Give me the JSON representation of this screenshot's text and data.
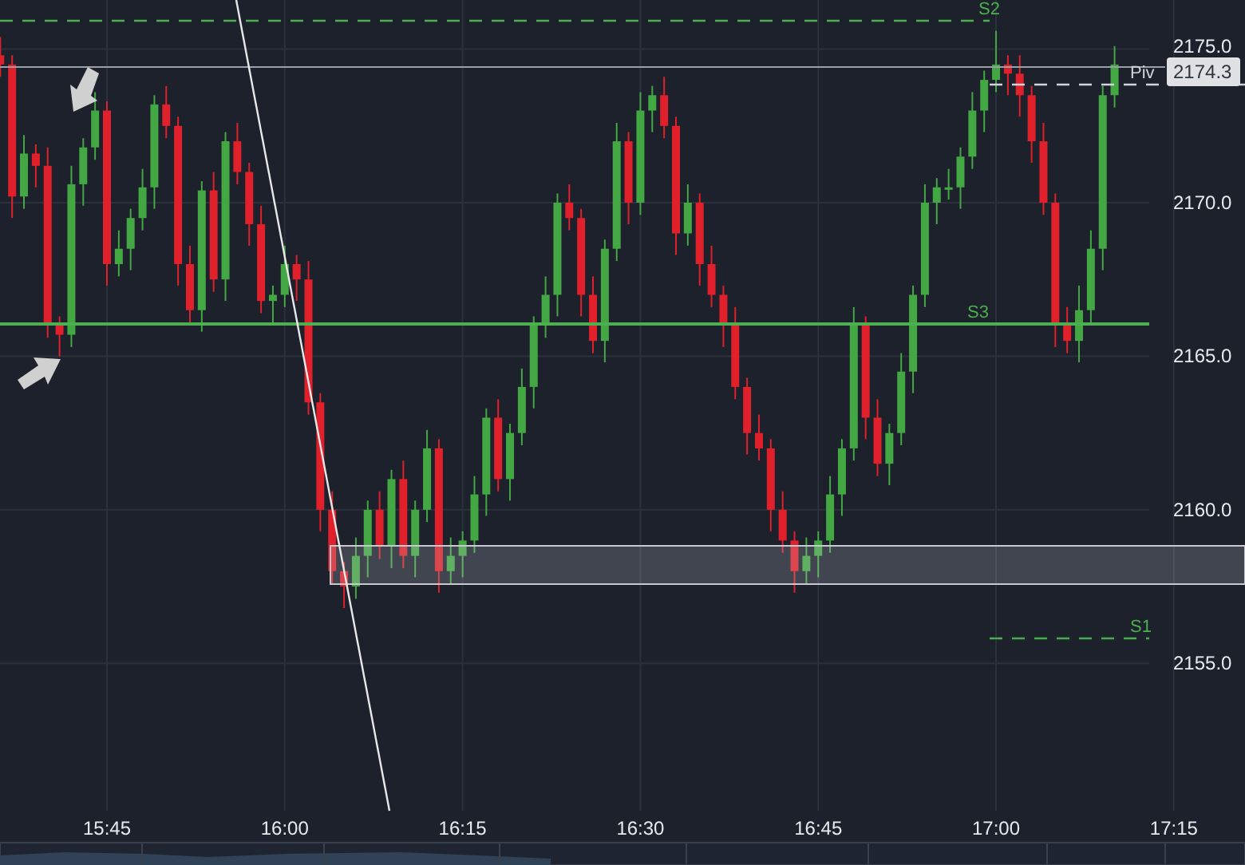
{
  "chart_data": {
    "type": "candlestick",
    "categories": [
      null,
      null,
      null,
      null,
      null,
      null,
      null,
      null,
      null,
      "15:45",
      null,
      null,
      null,
      null,
      null,
      null,
      null,
      null,
      null,
      null,
      null,
      null,
      null,
      null,
      "16:00",
      null,
      null,
      null,
      null,
      null,
      null,
      null,
      null,
      null,
      null,
      null,
      null,
      null,
      null,
      "16:15",
      null,
      null,
      null,
      null,
      null,
      null,
      null,
      null,
      null,
      null,
      null,
      null,
      null,
      null,
      "16:30",
      null,
      null,
      null,
      null,
      null,
      null,
      null,
      null,
      null,
      null,
      null,
      null,
      null,
      null,
      "16:45",
      null,
      null,
      null,
      null,
      null,
      null,
      null,
      null,
      null,
      null,
      null,
      null,
      null,
      null,
      "17:00",
      null,
      null,
      null,
      null,
      null,
      null,
      null,
      null,
      null,
      null,
      null,
      null,
      null,
      null,
      "17:15"
    ],
    "ylim": [
      2150.2,
      2176.6
    ],
    "grid": true,
    "ohlc": [
      [
        2174.8,
        2175.4,
        2174.1,
        2174.5
      ],
      [
        2174.5,
        2174.8,
        2169.5,
        2170.2
      ],
      [
        2170.2,
        2172.2,
        2169.8,
        2171.6
      ],
      [
        2171.6,
        2171.9,
        2170.5,
        2171.2
      ],
      [
        2171.2,
        2171.8,
        2165.6,
        2166.0
      ],
      [
        2166.0,
        2166.3,
        2165.0,
        2165.7
      ],
      [
        2165.7,
        2171.2,
        2165.3,
        2170.6
      ],
      [
        2170.6,
        2172.1,
        2169.9,
        2171.8
      ],
      [
        2171.8,
        2173.6,
        2171.4,
        2173.0
      ],
      [
        2173.0,
        2173.3,
        2167.3,
        2168.0
      ],
      [
        2168.0,
        2169.1,
        2167.6,
        2168.5
      ],
      [
        2168.5,
        2169.8,
        2167.8,
        2169.5
      ],
      [
        2169.5,
        2171.1,
        2169.1,
        2170.5
      ],
      [
        2170.5,
        2173.5,
        2169.8,
        2173.2
      ],
      [
        2173.2,
        2173.8,
        2172.1,
        2172.5
      ],
      [
        2172.5,
        2172.8,
        2167.3,
        2168.0
      ],
      [
        2168.0,
        2168.6,
        2166.1,
        2166.5
      ],
      [
        2166.5,
        2170.7,
        2165.8,
        2170.4
      ],
      [
        2170.4,
        2171.0,
        2167.1,
        2167.5
      ],
      [
        2167.5,
        2172.3,
        2166.8,
        2172.0
      ],
      [
        2172.0,
        2172.6,
        2170.6,
        2171.0
      ],
      [
        2171.0,
        2171.3,
        2168.6,
        2169.3
      ],
      [
        2169.3,
        2169.9,
        2166.4,
        2166.8
      ],
      [
        2166.8,
        2167.3,
        2166.1,
        2167.0
      ],
      [
        2167.0,
        2168.6,
        2166.6,
        2168.0
      ],
      [
        2168.0,
        2168.3,
        2166.8,
        2167.5
      ],
      [
        2167.5,
        2168.1,
        2163.1,
        2163.5
      ],
      [
        2163.5,
        2163.8,
        2159.3,
        2160.0
      ],
      [
        2160.0,
        2160.6,
        2157.6,
        2158.0
      ],
      [
        2158.0,
        2158.3,
        2156.8,
        2157.5
      ],
      [
        2157.5,
        2159.1,
        2157.1,
        2158.5
      ],
      [
        2158.5,
        2160.3,
        2157.8,
        2160.0
      ],
      [
        2160.0,
        2160.6,
        2158.4,
        2158.8
      ],
      [
        2158.8,
        2161.3,
        2158.1,
        2161.0
      ],
      [
        2161.0,
        2161.6,
        2158.1,
        2158.5
      ],
      [
        2158.5,
        2160.3,
        2157.8,
        2160.0
      ],
      [
        2160.0,
        2162.6,
        2159.6,
        2162.0
      ],
      [
        2162.0,
        2162.3,
        2157.3,
        2158.0
      ],
      [
        2158.0,
        2159.1,
        2157.6,
        2158.5
      ],
      [
        2158.5,
        2159.3,
        2157.8,
        2159.0
      ],
      [
        2159.0,
        2161.1,
        2158.6,
        2160.5
      ],
      [
        2160.5,
        2163.3,
        2159.8,
        2163.0
      ],
      [
        2163.0,
        2163.6,
        2160.6,
        2161.0
      ],
      [
        2161.0,
        2162.8,
        2160.3,
        2162.5
      ],
      [
        2162.5,
        2164.6,
        2162.1,
        2164.0
      ],
      [
        2164.0,
        2166.3,
        2163.3,
        2166.0
      ],
      [
        2166.0,
        2167.6,
        2165.6,
        2167.0
      ],
      [
        2167.0,
        2170.3,
        2166.3,
        2170.0
      ],
      [
        2170.0,
        2170.6,
        2169.1,
        2169.5
      ],
      [
        2169.5,
        2169.8,
        2166.3,
        2167.0
      ],
      [
        2167.0,
        2167.6,
        2165.1,
        2165.5
      ],
      [
        2165.5,
        2168.8,
        2164.8,
        2168.5
      ],
      [
        2168.5,
        2172.6,
        2168.1,
        2172.0
      ],
      [
        2172.0,
        2172.3,
        2169.3,
        2170.0
      ],
      [
        2170.0,
        2173.6,
        2169.6,
        2173.0
      ],
      [
        2173.0,
        2173.8,
        2172.3,
        2173.5
      ],
      [
        2173.5,
        2174.1,
        2172.1,
        2172.5
      ],
      [
        2172.5,
        2172.8,
        2168.3,
        2169.0
      ],
      [
        2169.0,
        2170.6,
        2168.6,
        2170.0
      ],
      [
        2170.0,
        2170.3,
        2167.3,
        2168.0
      ],
      [
        2168.0,
        2168.6,
        2166.6,
        2167.0
      ],
      [
        2167.0,
        2167.3,
        2165.3,
        2166.0
      ],
      [
        2166.0,
        2166.6,
        2163.6,
        2164.0
      ],
      [
        2164.0,
        2164.3,
        2161.8,
        2162.5
      ],
      [
        2162.5,
        2163.1,
        2161.6,
        2162.0
      ],
      [
        2162.0,
        2162.3,
        2159.3,
        2160.0
      ],
      [
        2160.0,
        2160.6,
        2158.6,
        2159.0
      ],
      [
        2159.0,
        2159.3,
        2157.3,
        2158.0
      ],
      [
        2158.0,
        2159.1,
        2157.6,
        2158.5
      ],
      [
        2158.5,
        2159.3,
        2157.8,
        2159.0
      ],
      [
        2159.0,
        2161.1,
        2158.6,
        2160.5
      ],
      [
        2160.5,
        2162.3,
        2159.8,
        2162.0
      ],
      [
        2162.0,
        2166.6,
        2161.6,
        2166.0
      ],
      [
        2166.0,
        2166.3,
        2162.3,
        2163.0
      ],
      [
        2163.0,
        2163.6,
        2161.1,
        2161.5
      ],
      [
        2161.5,
        2162.8,
        2160.8,
        2162.5
      ],
      [
        2162.5,
        2165.1,
        2162.1,
        2164.5
      ],
      [
        2164.5,
        2167.3,
        2163.8,
        2167.0
      ],
      [
        2167.0,
        2170.6,
        2166.6,
        2170.0
      ],
      [
        2170.0,
        2170.8,
        2169.3,
        2170.5
      ],
      [
        2170.5,
        2171.1,
        2170.1,
        2170.5
      ],
      [
        2170.5,
        2171.8,
        2169.8,
        2171.5
      ],
      [
        2171.5,
        2173.6,
        2171.1,
        2173.0
      ],
      [
        2173.0,
        2174.3,
        2172.3,
        2174.0
      ],
      [
        2174.0,
        2175.6,
        2173.6,
        2174.5
      ],
      [
        2174.5,
        2174.8,
        2173.5,
        2174.2
      ],
      [
        2174.2,
        2174.8,
        2172.8,
        2173.5
      ],
      [
        2173.5,
        2173.8,
        2171.3,
        2172.0
      ],
      [
        2172.0,
        2172.6,
        2169.6,
        2170.0
      ],
      [
        2170.0,
        2170.3,
        2165.3,
        2166.0
      ],
      [
        2166.0,
        2166.6,
        2165.1,
        2165.5
      ],
      [
        2165.5,
        2167.3,
        2164.8,
        2166.5
      ],
      [
        2166.5,
        2169.1,
        2166.1,
        2168.5
      ],
      [
        2168.5,
        2173.8,
        2167.8,
        2173.5
      ],
      [
        2173.5,
        2175.1,
        2173.1,
        2174.5
      ],
      null,
      null,
      null,
      null,
      null
    ],
    "yticks": [
      {
        "value": 2175,
        "label": "2175.0"
      },
      {
        "value": 2170,
        "label": "2170.0"
      },
      {
        "value": 2165,
        "label": "2165.0"
      },
      {
        "value": 2160,
        "label": "2160.0"
      },
      {
        "value": 2155,
        "label": "2155.0"
      }
    ]
  },
  "levels": [
    {
      "label": "S2",
      "kind": "dashed",
      "color": "#4caf50"
    },
    {
      "label": "Piv",
      "kind": "dashed",
      "color": "#d1d4dc"
    },
    {
      "label": "S3",
      "kind": "solid",
      "color": "#4caf50"
    },
    {
      "label": "S1",
      "kind": "dashed",
      "color": "#4caf50"
    }
  ],
  "price_tag": "2174.3"
}
